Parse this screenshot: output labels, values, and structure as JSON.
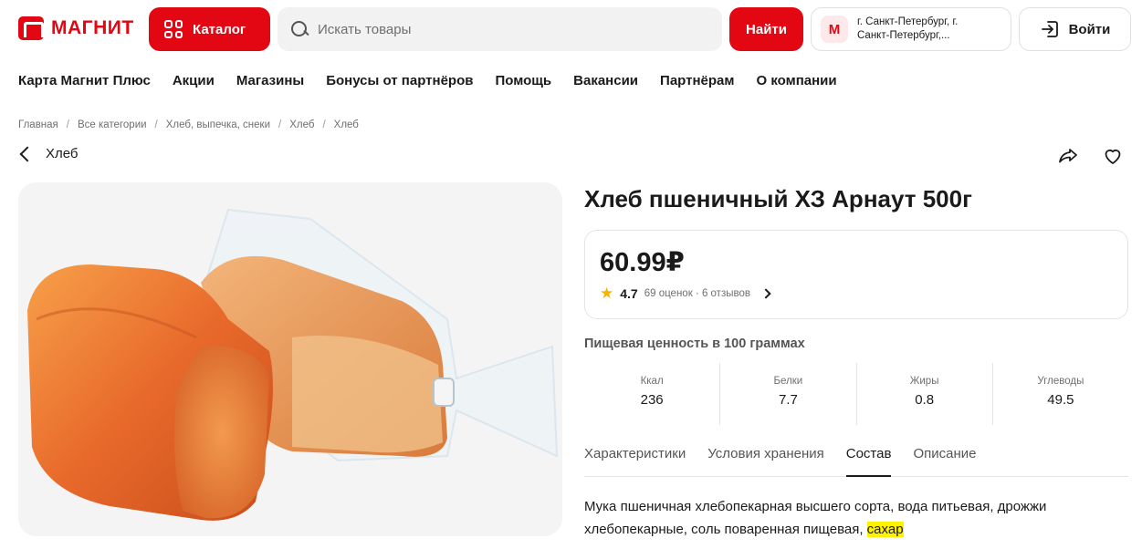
{
  "brand": {
    "name": "МАГНИТ",
    "color": "#e30613"
  },
  "header": {
    "catalog_label": "Каталог",
    "search_placeholder": "Искать товары",
    "find_label": "Найти",
    "store_badge": "М",
    "store_line1": "г. Санкт-Петербург, г.",
    "store_line2": "Санкт-Петербург,...",
    "login_label": "Войти"
  },
  "nav": [
    "Карта Магнит Плюс",
    "Акции",
    "Магазины",
    "Бонусы от партнёров",
    "Помощь",
    "Вакансии",
    "Партнёрам",
    "О компании"
  ],
  "breadcrumb": [
    "Главная",
    "Все категории",
    "Хлеб, выпечка, снеки",
    "Хлеб",
    "Хлеб"
  ],
  "back_label": "Хлеб",
  "product": {
    "title": "Хлеб пшеничный ХЗ Арнаут 500г",
    "price": "60.99₽",
    "rating": "4.7",
    "reviews": "69 оценок · 6 отзывов"
  },
  "nutrition": {
    "title": "Пищевая ценность в 100 граммах",
    "items": [
      {
        "label": "Ккал",
        "value": "236"
      },
      {
        "label": "Белки",
        "value": "7.7"
      },
      {
        "label": "Жиры",
        "value": "0.8"
      },
      {
        "label": "Углеводы",
        "value": "49.5"
      }
    ]
  },
  "tabs": [
    {
      "label": "Характеристики",
      "active": false
    },
    {
      "label": "Условия хранения",
      "active": false
    },
    {
      "label": "Состав",
      "active": true
    },
    {
      "label": "Описание",
      "active": false
    }
  ],
  "composition": {
    "text": "Мука пшеничная хлебопекарная высшего сорта, вода питьевая, дрожжи хлебопекарные, соль поваренная пищевая, ",
    "highlight": "сахар"
  },
  "icons": [
    "catalog-grid-icon",
    "search-icon",
    "login-icon",
    "chevron-left-icon",
    "share-icon",
    "heart-icon",
    "star-icon",
    "chevron-right-icon"
  ]
}
